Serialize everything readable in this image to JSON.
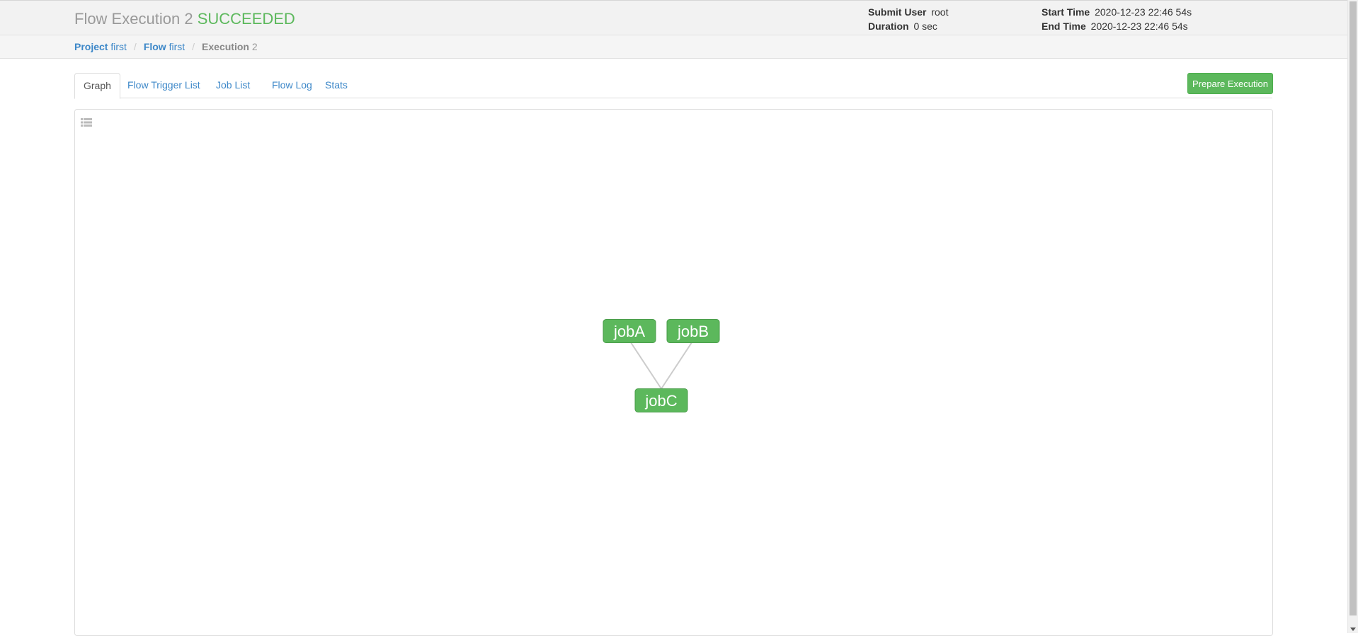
{
  "header": {
    "title_prefix": "Flow Execution",
    "execution_id": "2",
    "status": "SUCCEEDED",
    "status_color": "#5cb85c",
    "submit_user_label": "Submit User",
    "submit_user": "root",
    "duration_label": "Duration",
    "duration": "0 sec",
    "start_time_label": "Start Time",
    "start_time": "2020-12-23 22:46 54s",
    "end_time_label": "End Time",
    "end_time": "2020-12-23 22:46 54s"
  },
  "breadcrumb": {
    "project_label": "Project",
    "project_name": "first",
    "flow_label": "Flow",
    "flow_name": "first",
    "execution_label": "Execution",
    "execution_id": "2",
    "separator": "/"
  },
  "tabs": {
    "graph": "Graph",
    "flow_trigger_list": "Flow Trigger List",
    "job_list": "Job List",
    "flow_log": "Flow Log",
    "stats": "Stats",
    "active": "Graph"
  },
  "actions": {
    "prepare_execution": "Prepare Execution"
  },
  "graph": {
    "nodes": [
      {
        "id": "jobA",
        "label": "jobA",
        "status": "succeeded"
      },
      {
        "id": "jobB",
        "label": "jobB",
        "status": "succeeded"
      },
      {
        "id": "jobC",
        "label": "jobC",
        "status": "succeeded"
      }
    ],
    "edges": [
      {
        "from": "jobA",
        "to": "jobC"
      },
      {
        "from": "jobB",
        "to": "jobC"
      }
    ],
    "node_color": "#5cb85c",
    "edge_color": "#cccccc"
  },
  "icons": {
    "list_toggle": "list-icon"
  }
}
